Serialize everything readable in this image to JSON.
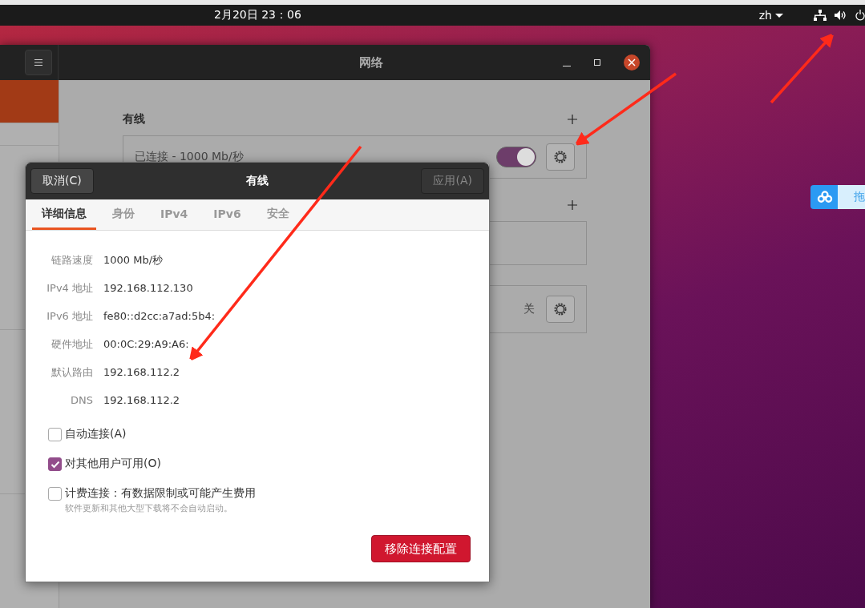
{
  "top_bar": {
    "clock": "2月20日  23：06",
    "language": "zh"
  },
  "settings_window": {
    "title": "网络",
    "sidebar": {
      "items": [
        {
          "selected": true
        },
        {
          "selected": false
        },
        {
          "selected": false
        },
        {
          "selected": false
        }
      ]
    },
    "sections": [
      {
        "heading": "有线",
        "add": true,
        "cards": [
          {
            "kind": "connection",
            "status": "已连接 - 1000 Mb/秒",
            "on": true
          }
        ]
      },
      {
        "add": true,
        "cards": [
          {
            "kind": "empty"
          }
        ]
      },
      {
        "add": false,
        "cards": [
          {
            "kind": "setting",
            "value": "关"
          }
        ]
      }
    ]
  },
  "dialog": {
    "title": "有线",
    "cancel": "取消(C)",
    "apply": {
      "label": "应用(A)",
      "disabled": true
    },
    "tabs": [
      {
        "label": "详细信息",
        "selected": true
      },
      {
        "label": "身份",
        "selected": false
      },
      {
        "label": "IPv4",
        "selected": false
      },
      {
        "label": "IPv6",
        "selected": false
      },
      {
        "label": "安全",
        "selected": false
      }
    ],
    "details": [
      {
        "label": "链路速度",
        "value": "1000 Mb/秒"
      },
      {
        "label": "IPv4 地址",
        "value": "192.168.112.130"
      },
      {
        "label": "IPv6 地址",
        "value": "fe80::d2cc:a7ad:5b4:"
      },
      {
        "label": "硬件地址",
        "value": "00:0C:29:A9:A6:"
      },
      {
        "label": "默认路由",
        "value": "192.168.112.2"
      },
      {
        "label": "DNS",
        "value": "192.168.112.2"
      }
    ],
    "options": [
      {
        "label": "自动连接(A)",
        "checked": false
      },
      {
        "label": "对其他用户可用(O)",
        "checked": true
      },
      {
        "label": "计费连接：有数据限制或可能产生费用",
        "hint": "软件更新和其他大型下载将不会自动启动。",
        "checked": false
      }
    ],
    "remove_button": "移除连接配置"
  },
  "side_widget": {
    "label": "拖"
  }
}
